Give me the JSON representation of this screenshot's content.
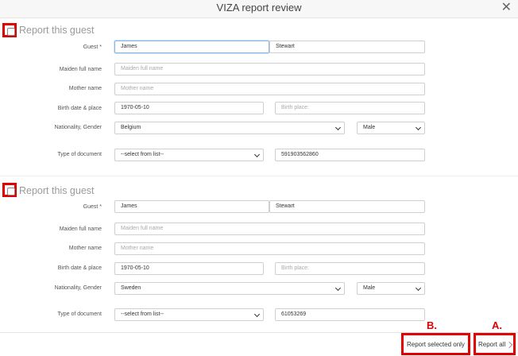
{
  "dialog": {
    "title": "VIZA report review",
    "close_symbol": "✕"
  },
  "labels": {
    "report_guest": "Report this guest",
    "guest": "Guest *",
    "maiden": "Maiden full name",
    "mother": "Mother name",
    "birth": "Birth date & place",
    "nationality": "Nationality, Gender",
    "doc_type": "Type of document"
  },
  "guests": [
    {
      "first_name": "James",
      "last_name": "Stewart",
      "maiden_placeholder": "Maiden full name",
      "mother_placeholder": "Mother name",
      "birth_date": "1970-05-10",
      "birth_place_placeholder": "Birth place:",
      "nationality": "Belgium",
      "gender": "Male",
      "doc_type": "--select from list--",
      "doc_number": "591903562860"
    },
    {
      "first_name": "James",
      "last_name": "Stewart",
      "maiden_placeholder": "Maiden full name",
      "mother_placeholder": "Mother name",
      "birth_date": "1970-05-10",
      "birth_place_placeholder": "Birth place:",
      "nationality": "Sweden",
      "gender": "Male",
      "doc_type": "--select from list--",
      "doc_number": "61053269"
    }
  ],
  "footer": {
    "report_selected": "Report selected only",
    "report_all": "Report all"
  },
  "annotations": {
    "a": "A.",
    "b": "B."
  },
  "colors": {
    "highlight": "#e00000",
    "focus_border": "#86b7e6"
  }
}
